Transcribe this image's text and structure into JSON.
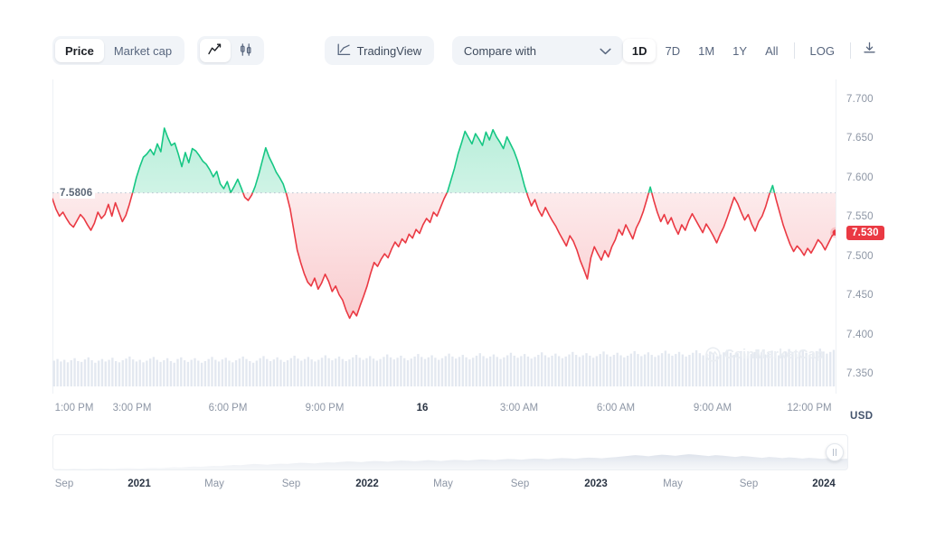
{
  "toolbar": {
    "metric_tabs": [
      {
        "label": "Price",
        "active": true
      },
      {
        "label": "Market cap",
        "active": false
      }
    ],
    "chart_type_tabs": [
      {
        "icon": "line-chart-icon",
        "active": true
      },
      {
        "icon": "candlestick-chart-icon",
        "active": false
      }
    ],
    "tradingview_label": "TradingView",
    "tradingview_icon": "tradingview-icon",
    "compare_label": "Compare with",
    "compare_caret_icon": "chevron-down-icon",
    "ranges": [
      {
        "label": "1D",
        "active": true
      },
      {
        "label": "7D",
        "active": false
      },
      {
        "label": "1M",
        "active": false
      },
      {
        "label": "1Y",
        "active": false
      },
      {
        "label": "All",
        "active": false
      }
    ],
    "log_label": "LOG",
    "download_icon": "download-icon"
  },
  "watermark": "CoinMarketCap",
  "chart_data": {
    "type": "line",
    "title": "",
    "xlabel": "",
    "ylabel": "USD",
    "currency": "USD",
    "ylim": [
      7.325,
      7.725
    ],
    "y_ticks": [
      "7.700",
      "7.650",
      "7.600",
      "7.550",
      "7.500",
      "7.450",
      "7.400",
      "7.350"
    ],
    "y_tick_values": [
      7.7,
      7.65,
      7.6,
      7.55,
      7.5,
      7.45,
      7.4,
      7.35
    ],
    "x_ticks": [
      "1:00 PM",
      "3:00 PM",
      "6:00 PM",
      "9:00 PM",
      "16",
      "3:00 AM",
      "6:00 AM",
      "9:00 AM",
      "12:00 PM"
    ],
    "x_tick_bold": [
      false,
      false,
      false,
      false,
      true,
      false,
      false,
      false,
      false
    ],
    "x_tick_positions": [
      82,
      146,
      252,
      359,
      467,
      574,
      681,
      788,
      895
    ],
    "grid": false,
    "legend": null,
    "reference_line": {
      "label": "7.5806",
      "value": 7.5806,
      "style": "dotted"
    },
    "current_price": {
      "label": "7.530",
      "value": 7.53,
      "color": "#ea3943",
      "marker": "dot"
    },
    "colors": {
      "up": "#16c784",
      "down": "#ea3943",
      "volume": "#ccd5e4",
      "axis_text": "#8d96a5"
    },
    "series": [
      {
        "name": "Price",
        "values": [
          7.573,
          7.56,
          7.551,
          7.556,
          7.548,
          7.541,
          7.537,
          7.545,
          7.553,
          7.548,
          7.54,
          7.533,
          7.542,
          7.556,
          7.548,
          7.553,
          7.566,
          7.551,
          7.568,
          7.556,
          7.544,
          7.552,
          7.566,
          7.582,
          7.6,
          7.614,
          7.626,
          7.63,
          7.636,
          7.629,
          7.643,
          7.633,
          7.663,
          7.651,
          7.641,
          7.644,
          7.63,
          7.614,
          7.632,
          7.619,
          7.637,
          7.634,
          7.628,
          7.621,
          7.617,
          7.61,
          7.601,
          7.608,
          7.592,
          7.586,
          7.595,
          7.581,
          7.589,
          7.598,
          7.587,
          7.575,
          7.571,
          7.578,
          7.589,
          7.604,
          7.621,
          7.638,
          7.626,
          7.617,
          7.607,
          7.6,
          7.592,
          7.578,
          7.56,
          7.534,
          7.508,
          7.492,
          7.478,
          7.467,
          7.462,
          7.472,
          7.458,
          7.466,
          7.477,
          7.468,
          7.455,
          7.462,
          7.451,
          7.444,
          7.431,
          7.421,
          7.43,
          7.424,
          7.437,
          7.449,
          7.462,
          7.478,
          7.492,
          7.487,
          7.496,
          7.503,
          7.498,
          7.509,
          7.518,
          7.512,
          7.522,
          7.517,
          7.528,
          7.523,
          7.534,
          7.529,
          7.54,
          7.548,
          7.543,
          7.556,
          7.551,
          7.562,
          7.573,
          7.582,
          7.597,
          7.612,
          7.63,
          7.644,
          7.659,
          7.651,
          7.643,
          7.656,
          7.649,
          7.641,
          7.658,
          7.648,
          7.661,
          7.652,
          7.645,
          7.637,
          7.652,
          7.643,
          7.634,
          7.622,
          7.607,
          7.59,
          7.576,
          7.564,
          7.572,
          7.559,
          7.551,
          7.562,
          7.553,
          7.545,
          7.538,
          7.529,
          7.521,
          7.513,
          7.526,
          7.519,
          7.508,
          7.494,
          7.483,
          7.471,
          7.498,
          7.512,
          7.503,
          7.495,
          7.507,
          7.499,
          7.512,
          7.521,
          7.534,
          7.527,
          7.54,
          7.531,
          7.522,
          7.536,
          7.545,
          7.557,
          7.572,
          7.588,
          7.571,
          7.556,
          7.544,
          7.553,
          7.541,
          7.549,
          7.537,
          7.528,
          7.54,
          7.533,
          7.545,
          7.554,
          7.546,
          7.538,
          7.53,
          7.541,
          7.534,
          7.526,
          7.517,
          7.528,
          7.537,
          7.549,
          7.562,
          7.575,
          7.567,
          7.556,
          7.546,
          7.553,
          7.541,
          7.532,
          7.544,
          7.551,
          7.563,
          7.578,
          7.59,
          7.572,
          7.556,
          7.54,
          7.527,
          7.515,
          7.506,
          7.513,
          7.508,
          7.501,
          7.51,
          7.504,
          7.512,
          7.521,
          7.516,
          7.508,
          7.517,
          7.526,
          7.53
        ]
      }
    ],
    "volume": {
      "name": "Volume",
      "color": "#ccd5e4",
      "values": [
        0.62,
        0.66,
        0.6,
        0.64,
        0.58,
        0.63,
        0.68,
        0.61,
        0.59,
        0.65,
        0.7,
        0.63,
        0.57,
        0.62,
        0.66,
        0.6,
        0.64,
        0.69,
        0.61,
        0.58,
        0.63,
        0.67,
        0.72,
        0.65,
        0.6,
        0.64,
        0.58,
        0.62,
        0.67,
        0.71,
        0.64,
        0.59,
        0.63,
        0.68,
        0.61,
        0.57,
        0.66,
        0.7,
        0.63,
        0.59,
        0.64,
        0.68,
        0.62,
        0.57,
        0.61,
        0.66,
        0.71,
        0.64,
        0.6,
        0.65,
        0.69,
        0.62,
        0.58,
        0.63,
        0.67,
        0.72,
        0.66,
        0.61,
        0.57,
        0.62,
        0.68,
        0.73,
        0.66,
        0.61,
        0.65,
        0.7,
        0.64,
        0.59,
        0.63,
        0.68,
        0.74,
        0.67,
        0.62,
        0.66,
        0.71,
        0.65,
        0.6,
        0.64,
        0.69,
        0.75,
        0.68,
        0.63,
        0.67,
        0.72,
        0.66,
        0.61,
        0.65,
        0.7,
        0.76,
        0.69,
        0.64,
        0.68,
        0.73,
        0.67,
        0.62,
        0.66,
        0.71,
        0.77,
        0.7,
        0.65,
        0.69,
        0.74,
        0.68,
        0.63,
        0.67,
        0.72,
        0.78,
        0.71,
        0.66,
        0.7,
        0.75,
        0.69,
        0.64,
        0.68,
        0.73,
        0.79,
        0.72,
        0.67,
        0.71,
        0.76,
        0.7,
        0.65,
        0.69,
        0.74,
        0.8,
        0.73,
        0.68,
        0.72,
        0.77,
        0.71,
        0.66,
        0.7,
        0.75,
        0.81,
        0.74,
        0.69,
        0.73,
        0.78,
        0.72,
        0.67,
        0.71,
        0.76,
        0.82,
        0.75,
        0.7,
        0.74,
        0.79,
        0.73,
        0.68,
        0.72,
        0.77,
        0.83,
        0.76,
        0.71,
        0.75,
        0.8,
        0.74,
        0.69,
        0.73,
        0.78,
        0.84,
        0.77,
        0.72,
        0.76,
        0.81,
        0.75,
        0.7,
        0.74,
        0.79,
        0.85,
        0.78,
        0.73,
        0.77,
        0.82,
        0.76,
        0.71,
        0.75,
        0.8,
        0.86,
        0.79,
        0.74,
        0.78,
        0.83,
        0.77,
        0.72,
        0.76,
        0.81,
        0.87,
        0.8,
        0.75,
        0.79,
        0.84,
        0.78,
        0.73,
        0.77,
        0.82,
        0.88,
        0.81,
        0.76,
        0.8,
        0.85,
        0.79,
        0.74,
        0.78,
        0.83,
        0.89,
        0.82,
        0.77,
        0.81,
        0.86,
        0.8,
        0.75,
        0.79,
        0.84,
        0.9,
        0.83,
        0.78,
        0.82,
        0.87,
        0.81,
        0.76,
        0.8,
        0.85,
        0.91,
        0.84,
        0.79,
        0.83,
        0.88
      ]
    }
  },
  "navigator": {
    "x_ticks": [
      "Sep",
      "2021",
      "May",
      "Sep",
      "2022",
      "May",
      "Sep",
      "2023",
      "May",
      "Sep",
      "2024"
    ],
    "x_tick_bold": [
      false,
      true,
      false,
      false,
      true,
      false,
      false,
      true,
      false,
      false,
      true
    ],
    "x_tick_positions": [
      71,
      154,
      237,
      322,
      406,
      490,
      575,
      659,
      744,
      828,
      911
    ],
    "overview_values": [
      0.1,
      0.11,
      0.1,
      0.12,
      0.11,
      0.1,
      0.12,
      0.13,
      0.12,
      0.11,
      0.13,
      0.14,
      0.13,
      0.12,
      0.14,
      0.15,
      0.14,
      0.16,
      0.18,
      0.17,
      0.19,
      0.21,
      0.2,
      0.22,
      0.24,
      0.23,
      0.26,
      0.28,
      0.27,
      0.3,
      0.33,
      0.31,
      0.29,
      0.32,
      0.34,
      0.33,
      0.36,
      0.38,
      0.37,
      0.35,
      0.38,
      0.4,
      0.39,
      0.42,
      0.44,
      0.43,
      0.41,
      0.44,
      0.46,
      0.45,
      0.43,
      0.46,
      0.48,
      0.47,
      0.45,
      0.47,
      0.5,
      0.48,
      0.46,
      0.49,
      0.51,
      0.5,
      0.48,
      0.51,
      0.53,
      0.52,
      0.5,
      0.53,
      0.55,
      0.54,
      0.52,
      0.55,
      0.57,
      0.56,
      0.54,
      0.57,
      0.59,
      0.58,
      0.56,
      0.59,
      0.61,
      0.6,
      0.58,
      0.61,
      0.63,
      0.66,
      0.69,
      0.72,
      0.7,
      0.67,
      0.71,
      0.74,
      0.72,
      0.69,
      0.73,
      0.76,
      0.74,
      0.71,
      0.68,
      0.72,
      0.7,
      0.67,
      0.64,
      0.68,
      0.66,
      0.63,
      0.6,
      0.64,
      0.62,
      0.59,
      0.62,
      0.6,
      0.57,
      0.6,
      0.58,
      0.56,
      0.59,
      0.57,
      0.55,
      0.58
    ],
    "handle_icon": "drag-handle-icon"
  }
}
